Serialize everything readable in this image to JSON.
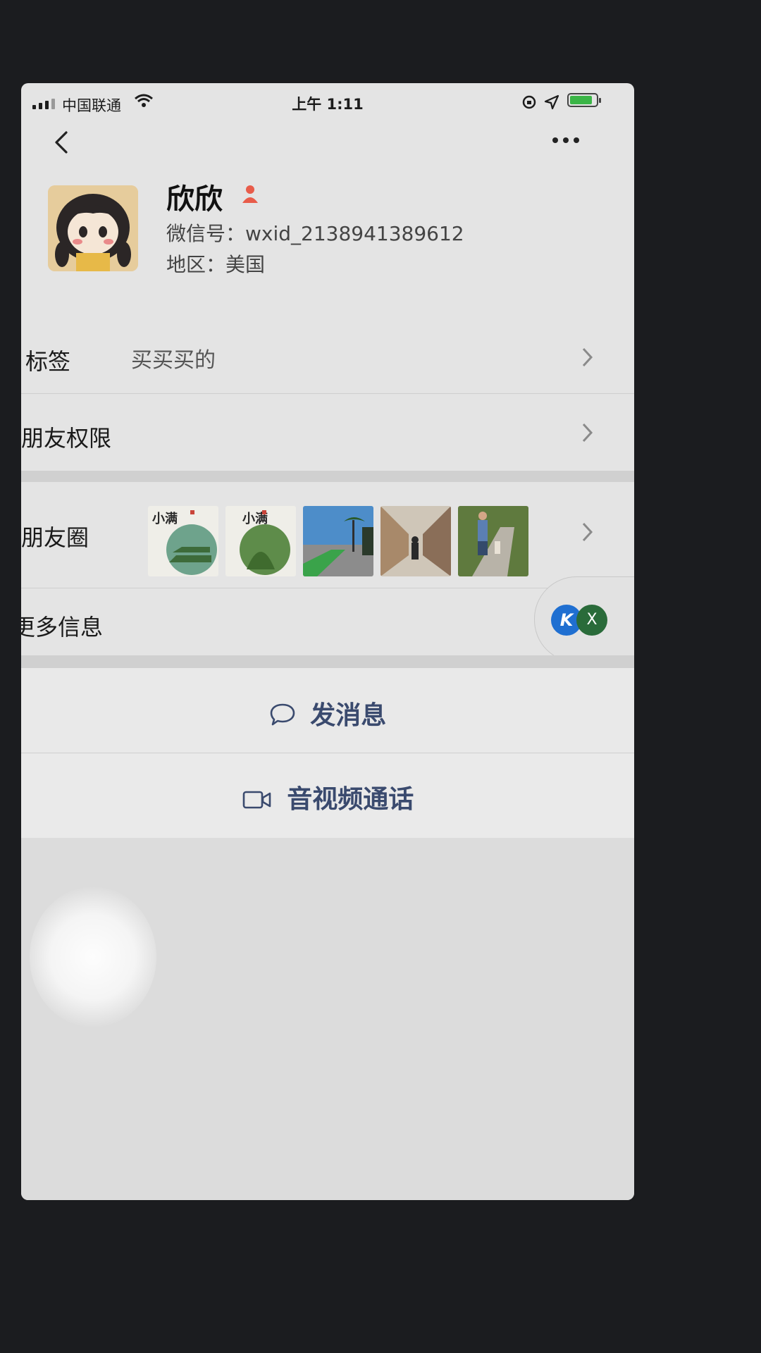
{
  "status_bar": {
    "carrier": "中国联通",
    "time": "上午 1:11",
    "battery_level": 0.85,
    "battery_color": "#3bb547"
  },
  "nav": {
    "back_icon": "chevron-left-icon",
    "more_icon": "ellipsis-icon"
  },
  "profile": {
    "name": "欣欣",
    "gender_icon": "female-person-icon",
    "gender_color": "#e85c4a",
    "wechat_id": "微信号：wxid_2138941389612",
    "region": "地区：美国"
  },
  "rows": {
    "tags_label": "标签",
    "tags_value": "买买买的",
    "permissions_label": "朋友权限",
    "moments_label": "朋友圈",
    "more_info_label": "更多信息"
  },
  "moments_thumbs": [
    {
      "text": "小满",
      "type": "poster"
    },
    {
      "text": "小满",
      "type": "poster"
    },
    {
      "type": "photo-palms"
    },
    {
      "type": "photo-aisle"
    },
    {
      "type": "photo-walk"
    }
  ],
  "floating_bubble": {
    "k_icon_letter": "K",
    "x_icon_letter": "X"
  },
  "actions": {
    "message_label": "发消息",
    "message_icon": "chat-bubble-icon",
    "call_label": "音视频通话",
    "call_icon": "video-camera-icon",
    "accent_color": "#3a4a6e"
  }
}
